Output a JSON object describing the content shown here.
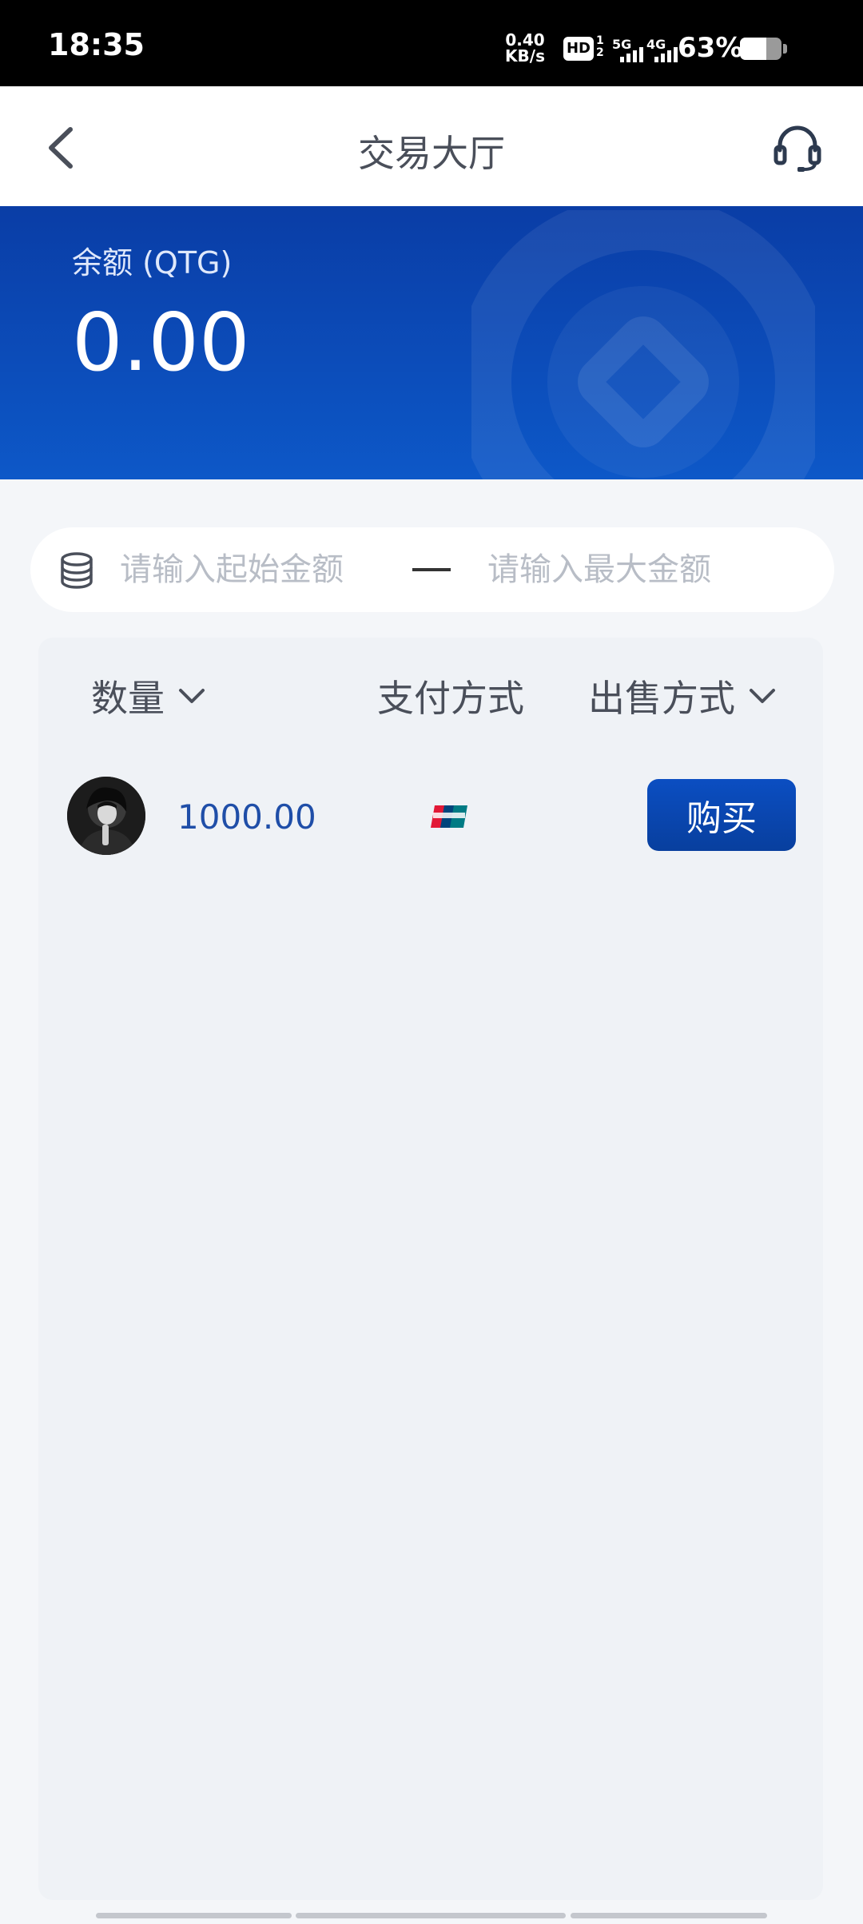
{
  "status_bar": {
    "time": "18:35",
    "net_speed_value": "0.40",
    "net_speed_unit": "KB/s",
    "hd": "HD",
    "hd_sub_top": "1",
    "hd_sub_bottom": "2",
    "sim1_gen": "5G",
    "sim2_gen": "4G",
    "battery_percent": "63%",
    "battery_level": 0.63
  },
  "header": {
    "title": "交易大厅",
    "back_icon": "chevron-left-icon",
    "support_icon": "headset-icon"
  },
  "balance": {
    "label": "余额 (QTG)",
    "value": "0.00"
  },
  "filter": {
    "min_placeholder": "请输入起始金额",
    "max_placeholder": "请输入最大金额",
    "min_value": "",
    "max_value": "",
    "icon": "coin-stack-icon"
  },
  "table": {
    "columns": {
      "quantity": "数量",
      "payment": "支付方式",
      "sale_method": "出售方式"
    },
    "rows": [
      {
        "amount": "1000.00",
        "payment_icon": "unionpay-icon",
        "action": "购买"
      }
    ]
  },
  "colors": {
    "brand_blue": "#0b4ec2",
    "banner_top": "#0a3da6",
    "banner_bottom": "#0d58c8",
    "amount_text": "#1f4ea8"
  }
}
